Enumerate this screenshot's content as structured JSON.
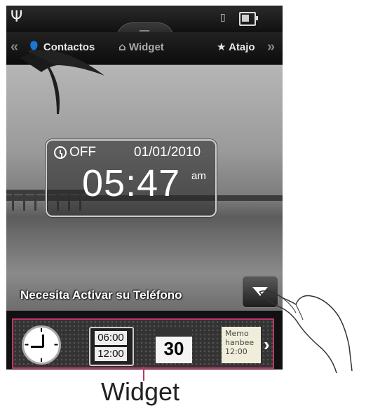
{
  "nav": {
    "contacts_label": "Contactos",
    "widget_label": "Widget",
    "shortcut_label": "Atajo"
  },
  "clock": {
    "alarm_status": "OFF",
    "date": "01/01/2010",
    "time": "05:47",
    "ampm": "am"
  },
  "notice": {
    "activate_text": "Necesita Activar su Teléfono"
  },
  "widgets": {
    "digital_top": "06:00",
    "digital_bottom": "12:00",
    "calendar_day": "30",
    "memo_line1": "Memo",
    "memo_line2": "hanbee",
    "memo_line3": "12:00"
  },
  "caption": {
    "label": "Widget"
  },
  "colors": {
    "callout": "#c0336d"
  },
  "icons": [
    "antenna-icon",
    "vibrate-icon",
    "battery-icon",
    "contact-person-icon",
    "home-icon",
    "star-icon",
    "alarm-clock-icon",
    "dropdown-arrow-icon",
    "chevron-left-icon",
    "chevron-right-icon"
  ]
}
